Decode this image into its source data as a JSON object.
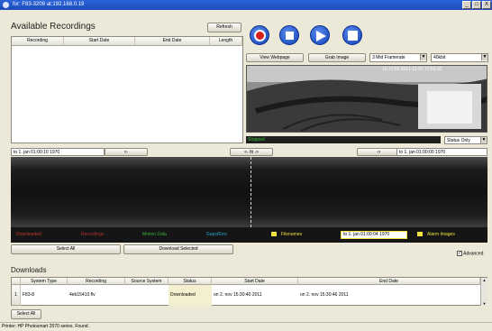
{
  "window": {
    "title": "for: F83-3209 at:192.168.0.19",
    "min": "_",
    "max": "□",
    "close": "X"
  },
  "recordings": {
    "heading": "Available Recordings",
    "refresh_label": "Refresh",
    "columns": [
      "Recording",
      "Start Date",
      "End Date",
      "Length"
    ]
  },
  "toolbar": {
    "icons": [
      "record-icon",
      "stop-icon",
      "play-icon",
      "save-icon"
    ],
    "view_webpage_label": "View Webpage",
    "grab_image_label": "Grab Image",
    "framerate_value": "3 Mid Framerate",
    "bitrate_value": "40kbit"
  },
  "video": {
    "overlay_text": "16:10:59  2011-11-03  10:53:32",
    "status_text": "Stopped",
    "status_filter": "Status Only"
  },
  "timeline": {
    "from_value": "to 1. jan 01:00:10 1970",
    "back_label": "<-",
    "fit_label": "<- fit ->",
    "forward_label": "->",
    "to_value": "to 1. jan 01:00:00 1970"
  },
  "legend": {
    "items": [
      {
        "label": "Downloaded",
        "color": "#c0392b"
      },
      {
        "label": "Recordings",
        "color": "#8b1a1a"
      },
      {
        "label": "Motion Data",
        "color": "#3cae3c"
      },
      {
        "label": "Gaps/Erro",
        "color": "#2ea3d6"
      },
      {
        "label": "Filenames",
        "color": "#f0e040"
      },
      {
        "label": "Alarm Images",
        "color": "#f0e040"
      }
    ],
    "current_time": "to 1. jan 01:00:04 1970"
  },
  "actions": {
    "select_all_label": "Select All",
    "download_selected_label": "Download Selected",
    "advanced_label": "Advanced",
    "advanced_checked": true
  },
  "downloads": {
    "heading": "Downloads",
    "columns": [
      "System Type",
      "Recording",
      "Source System",
      "Status",
      "Start Date",
      "End Date"
    ],
    "rows": [
      {
        "index": "1",
        "system_type": "F83-8",
        "recording": "4eb15410.flv",
        "source_system": "",
        "status": "Downloaded",
        "start": "on 2. nov 15:30:40 2011",
        "end": "on 2. nov 15:30:46 2011"
      }
    ],
    "select_all_label": "Select All"
  },
  "statusbar": {
    "text": "Printer: HP Photosmart 2570 series. Found."
  },
  "colors": {
    "titlebar": "#1c4bb8",
    "status_green": "#1b7a1b",
    "downloaded_row": "#f3efcf"
  }
}
